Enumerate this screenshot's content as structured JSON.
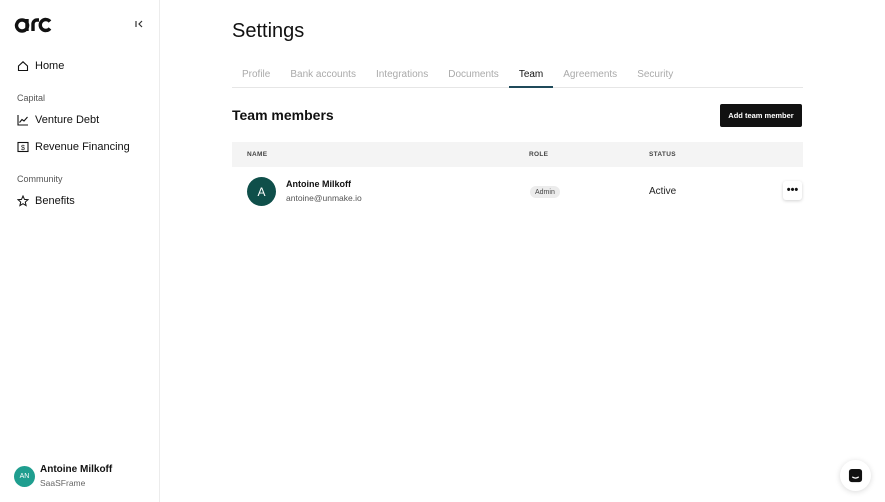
{
  "brand": {
    "logo_text": "arc"
  },
  "sidebar": {
    "items": [
      {
        "label": "Home",
        "icon": "home-icon"
      },
      {
        "label": "Venture Debt",
        "icon": "chart-icon"
      },
      {
        "label": "Revenue Financing",
        "icon": "dollar-icon"
      },
      {
        "label": "Benefits",
        "icon": "star-icon"
      }
    ],
    "sections": [
      "Capital",
      "Community"
    ],
    "user": {
      "initials": "AN",
      "name": "Antoine Milkoff",
      "org": "SaaSFrame"
    }
  },
  "page": {
    "title": "Settings",
    "tabs": [
      "Profile",
      "Bank accounts",
      "Integrations",
      "Documents",
      "Team",
      "Agreements",
      "Security"
    ],
    "active_tab": "Team"
  },
  "team": {
    "section_title": "Team members",
    "add_button": "Add team member",
    "columns": [
      "NAME",
      "ROLE",
      "STATUS"
    ],
    "members": [
      {
        "initial": "A",
        "name": "Antoine Milkoff",
        "email": "antoine@unmake.io",
        "role": "Admin",
        "status": "Active",
        "more": "•••"
      }
    ]
  },
  "colors": {
    "accent": "#1f4a5a",
    "avatar": "#0f4f4a",
    "user_avatar": "#1f9e8f"
  }
}
